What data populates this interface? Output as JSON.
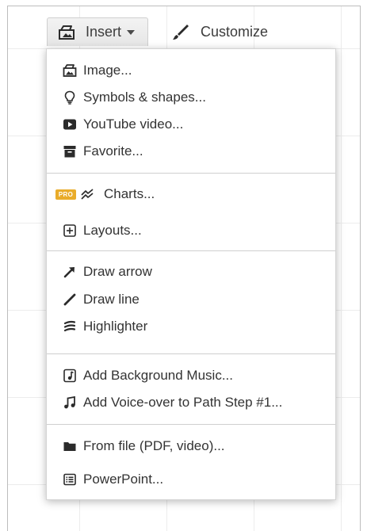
{
  "toolbar": {
    "insert_label": "Insert",
    "customize_label": "Customize"
  },
  "menu": {
    "image": "Image...",
    "symbols_shapes": "Symbols & shapes...",
    "youtube_video": "YouTube video...",
    "favorite": "Favorite...",
    "pro_badge": "PRO",
    "charts": "Charts...",
    "layouts": "Layouts...",
    "draw_arrow": "Draw arrow",
    "draw_line": "Draw line",
    "highlighter": "Highlighter",
    "add_background_music": "Add Background Music...",
    "add_voice_over": "Add Voice-over to Path Step #1...",
    "from_file": "From file (PDF, video)...",
    "powerpoint": "PowerPoint..."
  },
  "colors": {
    "pro_badge": "#e9ac2a",
    "icon": "#2b2b2b",
    "separator": "#cfcfcf"
  }
}
